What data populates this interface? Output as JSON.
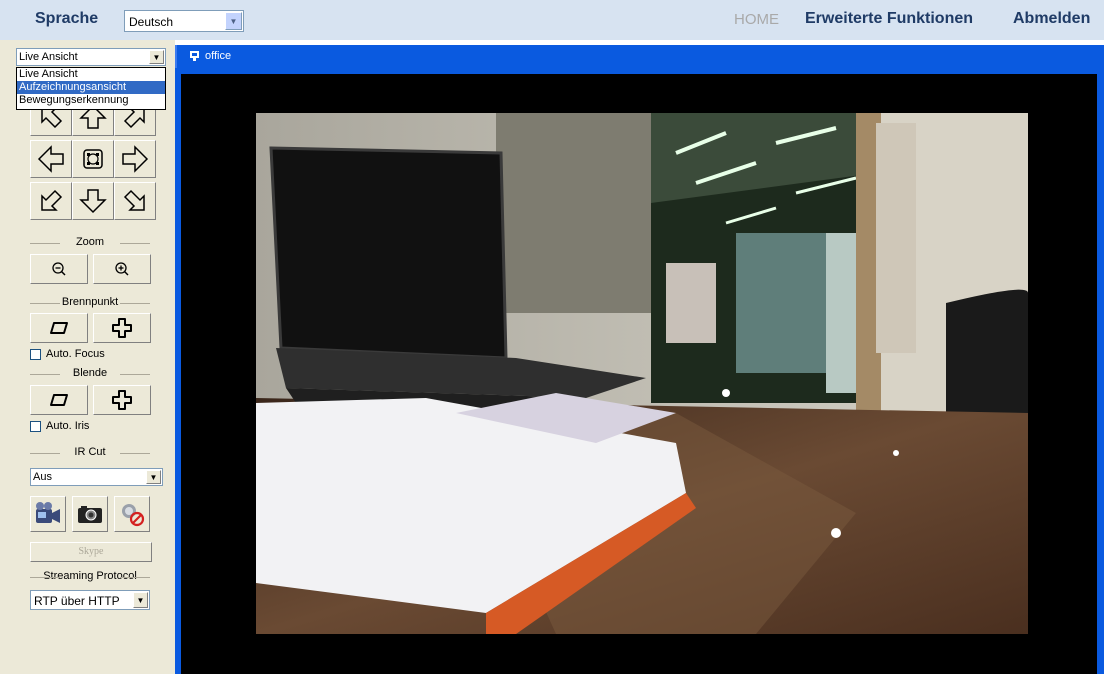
{
  "topbar": {
    "language_label": "Sprache",
    "language_value": "Deutsch",
    "nav_home": "HOME",
    "nav_advanced": "Erweiterte Funktionen",
    "nav_logout": "Abmelden"
  },
  "view_mode": {
    "selected": "Live Ansicht",
    "options": [
      "Live Ansicht",
      "Aufzeichnungsansicht",
      "Bewegungserkennung"
    ],
    "highlighted_index": 1
  },
  "controls": {
    "zoom_label": "Zoom",
    "focus_label": "Brennpunkt",
    "auto_focus_label": "Auto. Focus",
    "iris_label": "Blende",
    "auto_iris_label": "Auto. Iris",
    "ircut_label": "IR Cut",
    "ircut_value": "Aus",
    "skype_label": "Skype",
    "streaming_label": "Streaming Protocol",
    "streaming_value": "RTP über HTTP"
  },
  "video": {
    "camera_name": "office"
  },
  "colors": {
    "topbar_bg": "#d7e3f1",
    "nav_text": "#1f3b66",
    "panel_bg": "#ece9d8",
    "video_title_bg": "#0a5ae0",
    "selection": "#316ac5"
  }
}
